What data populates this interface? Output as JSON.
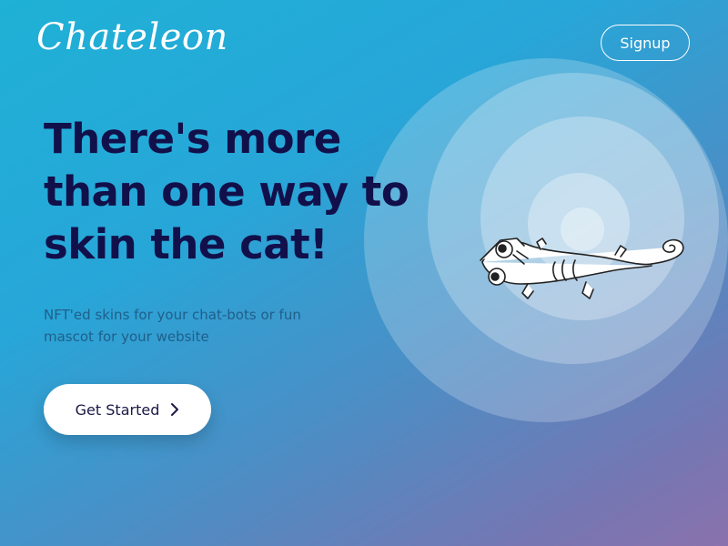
{
  "header": {
    "logo_text": "Chateleon",
    "signup_label": "Signup"
  },
  "hero": {
    "title": "There's more than one way to skin the cat!",
    "subtitle": "NFT'ed skins for your chat-bots or fun mascot for your website",
    "cta_label": "Get Started",
    "cta_icon": "chevron-right-icon"
  },
  "illustration": {
    "subject": "chameleon mascot line drawing",
    "rings": 5
  },
  "colors": {
    "title": "#12104a",
    "button_text": "#1a1845",
    "white": "#ffffff"
  }
}
